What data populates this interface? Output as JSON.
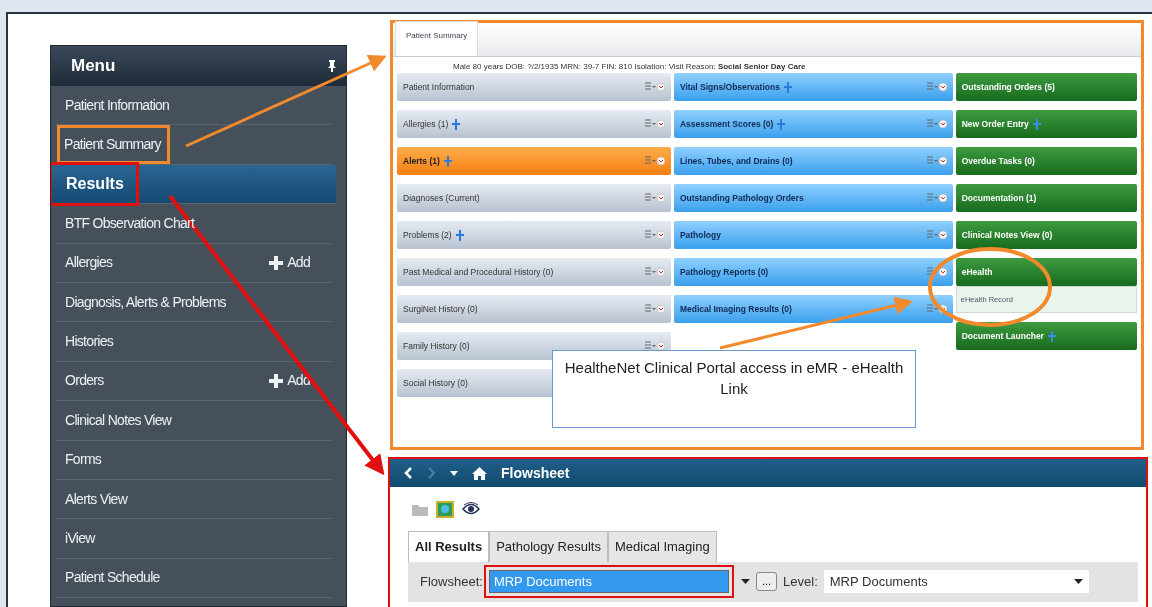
{
  "menu": {
    "title": "Menu",
    "items": [
      {
        "label": "Patient Information",
        "selected": false
      },
      {
        "label": "Patient Summary",
        "selected": false,
        "color": "#f08a2c"
      },
      {
        "label": "Results",
        "selected": true,
        "color": "#e01010"
      },
      {
        "label": "BTF Observation Chart",
        "selected": false
      },
      {
        "label": "Allergies",
        "selected": false,
        "action": "Add"
      },
      {
        "label": "Diagnosis, Alerts & Problems",
        "selected": false
      },
      {
        "label": "Histories",
        "selected": false
      },
      {
        "label": "Orders",
        "selected": false,
        "action": "Add"
      },
      {
        "label": "Clinical Notes View",
        "selected": false
      },
      {
        "label": "Forms",
        "selected": false
      },
      {
        "label": "Alerts View",
        "selected": false
      },
      {
        "label": "iView",
        "selected": false
      },
      {
        "label": "Patient Schedule",
        "selected": false
      }
    ]
  },
  "patient_summary": {
    "tab": "Patient Summary",
    "banner": "Male  80 years  DOB:  ?/2/1935  MRN: 39-7   FIN: 810   Isolation:  Visit Reason: **Social Senior Day Care**",
    "columns": [
      {
        "kind": "neutral",
        "components": [
          {
            "title": "Patient Information",
            "add": false,
            "alert": false
          },
          {
            "title": "Allergies (1)",
            "add": true,
            "alert": false
          },
          {
            "title": "Alerts (1)",
            "add": true,
            "alert": true
          },
          {
            "title": "Diagnoses (Current)",
            "add": false,
            "alert": false
          },
          {
            "title": "Problems (2)",
            "add": true,
            "alert": false
          },
          {
            "title": "Past Medical and Procedural History (0)",
            "add": false,
            "alert": false
          },
          {
            "title": "SurgiNet History (0)",
            "add": false,
            "alert": false
          },
          {
            "title": "Family History (0)",
            "add": false,
            "alert": false
          },
          {
            "title": "Social History (0)",
            "add": false,
            "alert": false
          }
        ]
      },
      {
        "kind": "info",
        "components": [
          {
            "title": "Vital Signs/Observations",
            "add": true,
            "alert": false
          },
          {
            "title": "Assessment Scores (0)",
            "add": true,
            "alert": false
          },
          {
            "title": "Lines, Tubes, and Drains (0)",
            "add": false,
            "alert": false
          },
          {
            "title": "Outstanding Pathology Orders",
            "add": false,
            "alert": false
          },
          {
            "title": "Pathology",
            "add": false,
            "alert": false
          },
          {
            "title": "Pathology Reports (0)",
            "add": false,
            "alert": false
          },
          {
            "title": "Medical Imaging Results (0)",
            "add": false,
            "alert": false
          }
        ]
      },
      {
        "kind": "action",
        "components": [
          {
            "title": "Outstanding Orders (5)",
            "add": false,
            "alert": false
          },
          {
            "title": "New Order Entry",
            "add": true,
            "alert": false
          },
          {
            "title": "Overdue Tasks (0)",
            "add": false,
            "alert": false
          },
          {
            "title": "Documentation (1)",
            "add": false,
            "alert": false
          },
          {
            "title": "Clinical Notes View (0)",
            "add": false,
            "alert": false
          },
          {
            "title": "eHealth",
            "add": false,
            "alert": false,
            "link": "eHealth Record"
          },
          {
            "title": "Document Launcher",
            "add": true,
            "alert": false
          }
        ]
      }
    ],
    "callout": "HealtheNet Clinical Portal access in eMR - eHealth Link"
  },
  "flowsheet": {
    "title": "Flowsheet",
    "tabs": [
      {
        "label": "All Results",
        "selected": true
      },
      {
        "label": "Pathology Results",
        "selected": false
      },
      {
        "label": "Medical Imaging",
        "selected": false
      }
    ],
    "flowsheet_label": "Flowsheet:",
    "flowsheet_value": "MRP Documents",
    "more_button": "...",
    "level_label": "Level:",
    "level_value": "MRP Documents"
  }
}
